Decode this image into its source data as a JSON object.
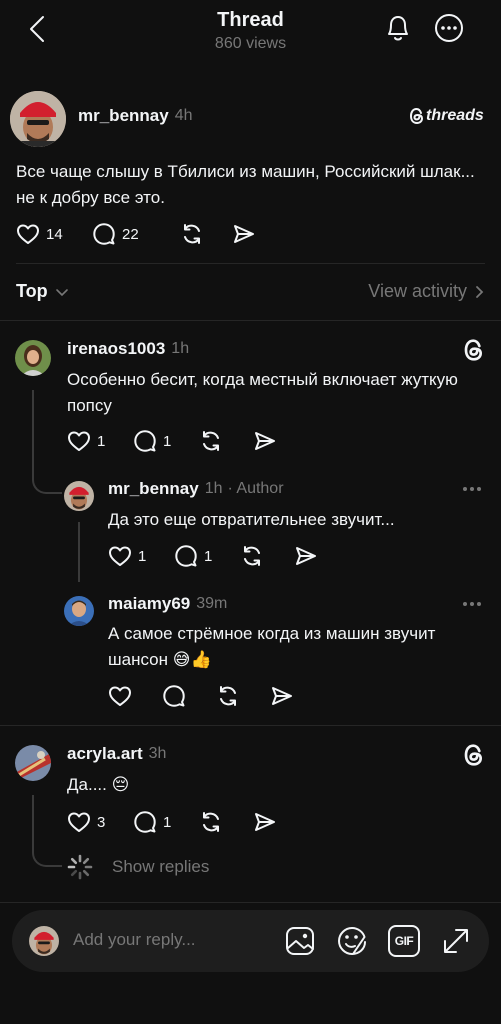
{
  "header": {
    "title": "Thread",
    "views": "860 views"
  },
  "post": {
    "username": "mr_bennay",
    "time": "4h",
    "brand": "threads",
    "text": "Все чаще слышу в Тбилиси из машин, Российский шлак... не к добру все это.",
    "likes": "14",
    "comments": "22"
  },
  "sort": {
    "label": "Top",
    "view_activity": "View activity"
  },
  "replies": [
    {
      "username": "irenaos1003",
      "time": "1h",
      "text": "Особенно бесит, когда местный включает жуткую попсу",
      "likes": "1",
      "comments": "1"
    },
    {
      "username": "mr_bennay",
      "time": "1h",
      "author_tag": "· Author",
      "text": "Да это еще отвратительнее звучит...",
      "likes": "1",
      "comments": "1"
    },
    {
      "username": "maiamy69",
      "time": "39m",
      "text": "А самое стрёмное когда из машин звучит шансон 😅👍"
    },
    {
      "username": "acryla.art",
      "time": "3h",
      "text": "Да.... 😔",
      "likes": "3",
      "comments": "1"
    }
  ],
  "show_replies": "Show replies",
  "composer": {
    "placeholder": "Add your reply...",
    "gif_label": "GIF"
  }
}
